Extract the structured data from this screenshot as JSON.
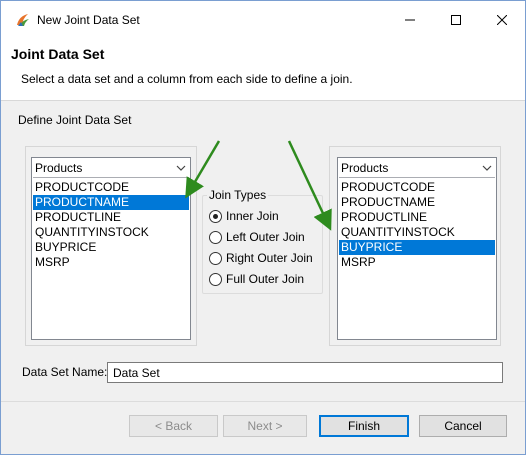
{
  "window": {
    "title": "New Joint Data Set"
  },
  "header": {
    "title": "Joint Data Set",
    "description": "Select a data set and a column from each side to define a join."
  },
  "section": {
    "label": "Define Joint Data Set"
  },
  "left_list": {
    "dataset": "Products",
    "items": [
      "PRODUCTCODE",
      "PRODUCTNAME",
      "PRODUCTLINE",
      "QUANTITYINSTOCK",
      "BUYPRICE",
      "MSRP"
    ],
    "selected": "PRODUCTNAME"
  },
  "right_list": {
    "dataset": "Products",
    "items": [
      "PRODUCTCODE",
      "PRODUCTNAME",
      "PRODUCTLINE",
      "QUANTITYINSTOCK",
      "BUYPRICE",
      "MSRP"
    ],
    "selected": "BUYPRICE"
  },
  "join_types": {
    "title": "Join Types",
    "options": [
      "Inner Join",
      "Left Outer Join",
      "Right Outer Join",
      "Full Outer Join"
    ],
    "selected": "Inner Join"
  },
  "dataset_name": {
    "label": "Data Set Name:",
    "value": "Data Set"
  },
  "buttons": {
    "back": "< Back",
    "next": "Next >",
    "finish": "Finish",
    "cancel": "Cancel"
  },
  "colors": {
    "selection": "#0078d7",
    "annotation_arrow": "#2e8b1e"
  }
}
